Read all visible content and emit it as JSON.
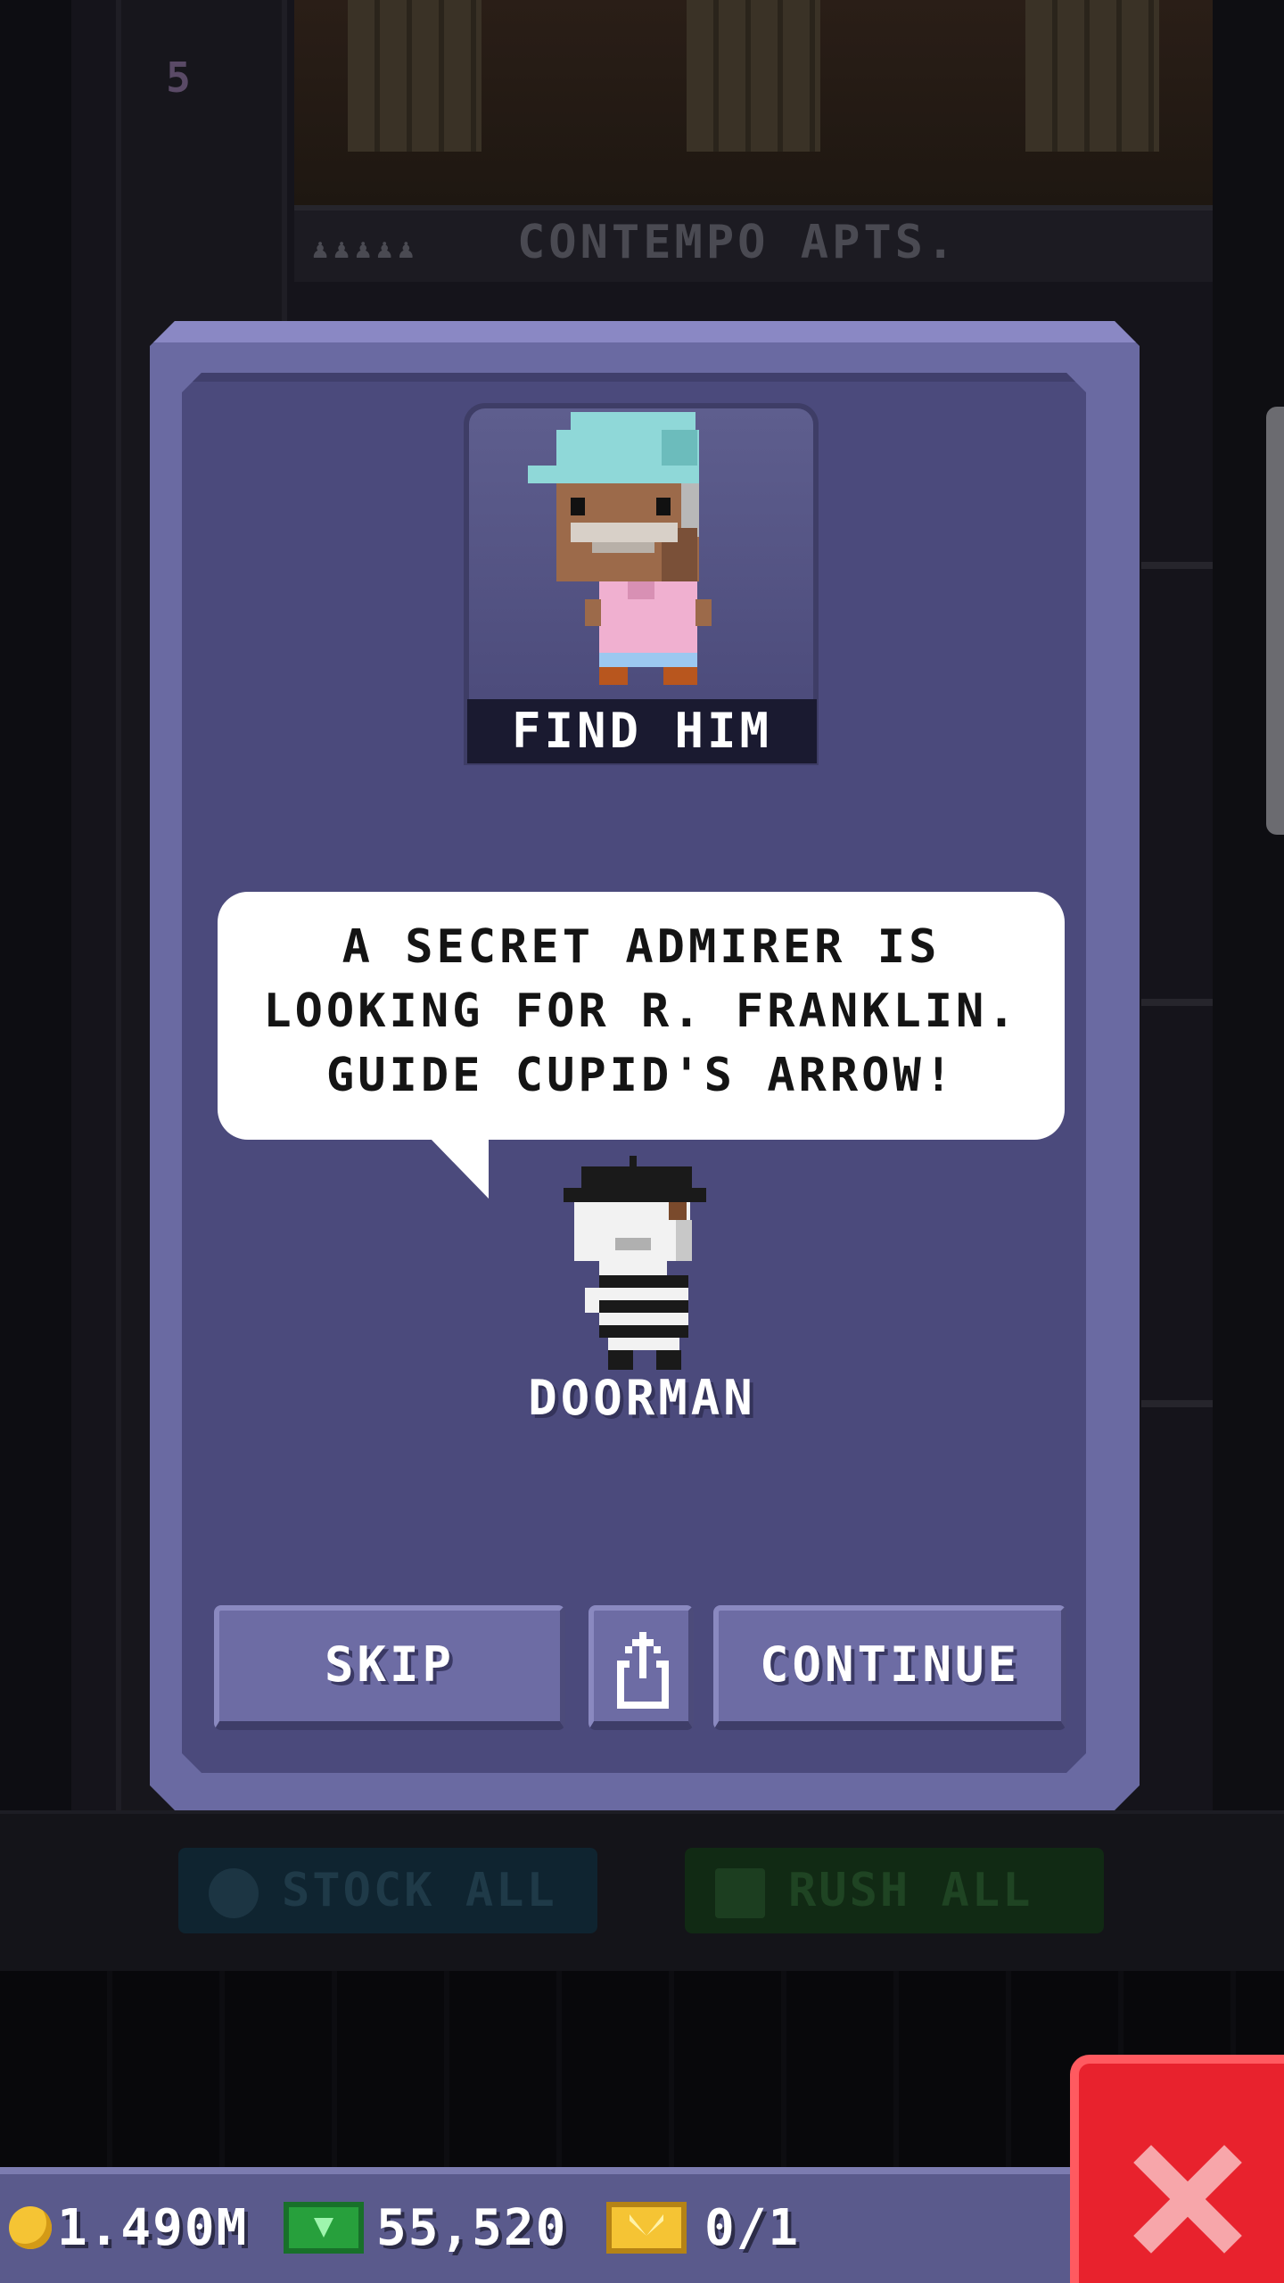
{
  "background": {
    "floor_label": "CONTEMPO APTS.",
    "floor_people": "♟♟♟♟♟",
    "elevator_floor_number": "5",
    "stock_all_label": "STOCK ALL",
    "rush_all_label": "RUSH ALL"
  },
  "dialog": {
    "portrait_button_label": "FIND HIM",
    "message_lines": [
      "A SECRET ADMIRER IS",
      "LOOKING FOR R. FRANKLIN.",
      "GUIDE CUPID'S ARROW!"
    ],
    "speaker_name": "DOORMAN",
    "skip_label": "SKIP",
    "continue_label": "CONTINUE",
    "share_icon": "share-icon"
  },
  "hud": {
    "coins": "1.490M",
    "bux": "55,520",
    "tickets": "0/1",
    "coin_icon": "coin-icon",
    "bux_icon": "cash-icon",
    "ticket_icon": "ticket-icon"
  },
  "close_icon": "close-icon",
  "colors": {
    "dialog_frame": "#6a6aa2",
    "dialog_inner": "#4b4a7c",
    "close_button": "#e8222d",
    "hud_bar": "#5a5a8c"
  }
}
